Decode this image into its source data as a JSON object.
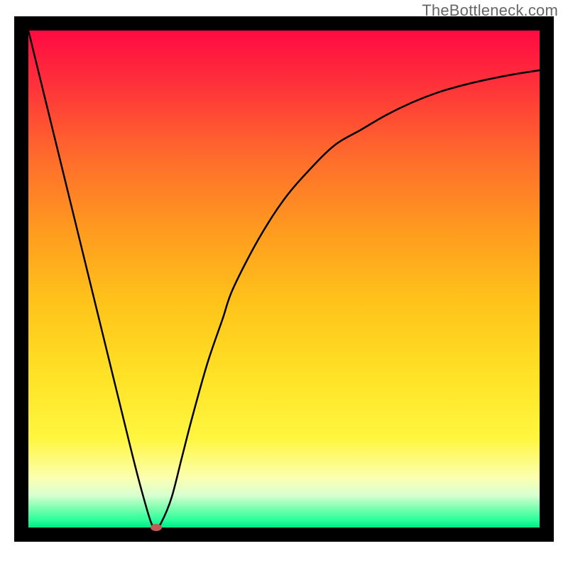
{
  "watermark": "TheBottleneck.com",
  "chart_data": {
    "type": "line",
    "title": "",
    "xlabel": "",
    "ylabel": "",
    "xlim": [
      0,
      100
    ],
    "ylim": [
      0,
      100
    ],
    "grid": false,
    "legend": false,
    "series": [
      {
        "name": "bottleneck-curve",
        "x": [
          0,
          5,
          10,
          15,
          20,
          22,
          24,
          25,
          26,
          28,
          30,
          32,
          35,
          38,
          40,
          45,
          50,
          55,
          60,
          65,
          70,
          75,
          80,
          85,
          90,
          95,
          100
        ],
        "y": [
          100,
          79,
          58,
          37,
          16,
          8,
          1,
          0,
          1,
          6,
          14,
          22,
          33,
          42,
          48,
          58,
          66,
          72,
          77,
          80,
          83,
          85.5,
          87.5,
          89,
          90.2,
          91.2,
          92
        ]
      }
    ],
    "markers": [
      {
        "name": "optimum-marker",
        "x": 25,
        "y": 0,
        "color": "#c35a55",
        "rx": 8,
        "ry": 5
      }
    ],
    "frame": {
      "outer_border": "#000000",
      "outer_border_width": 20
    },
    "background_gradient": {
      "stops": [
        {
          "offset": 0.0,
          "color": "#ff0a42"
        },
        {
          "offset": 0.1,
          "color": "#ff2e3b"
        },
        {
          "offset": 0.25,
          "color": "#ff6a2c"
        },
        {
          "offset": 0.4,
          "color": "#ff9a1f"
        },
        {
          "offset": 0.55,
          "color": "#ffc41a"
        },
        {
          "offset": 0.7,
          "color": "#ffe327"
        },
        {
          "offset": 0.82,
          "color": "#fff63f"
        },
        {
          "offset": 0.9,
          "color": "#fbffb0"
        },
        {
          "offset": 0.935,
          "color": "#d8ffd0"
        },
        {
          "offset": 0.96,
          "color": "#7fffb0"
        },
        {
          "offset": 0.985,
          "color": "#2aff9c"
        },
        {
          "offset": 1.0,
          "color": "#00e885"
        }
      ]
    }
  }
}
